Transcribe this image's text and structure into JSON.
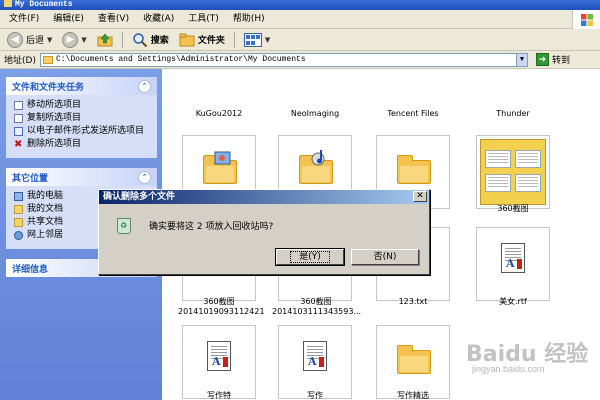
{
  "window": {
    "title": "My Documents"
  },
  "menubar": [
    "文件(F)",
    "编辑(E)",
    "查看(V)",
    "收藏(A)",
    "工具(T)",
    "帮助(H)"
  ],
  "toolbar": {
    "back_label": "后退",
    "search_label": "搜索",
    "folders_label": "文件夹"
  },
  "addressbar": {
    "label": "地址(D)",
    "path": "C:\\Documents and Settings\\Administrator\\My Documents",
    "go_label": "转到"
  },
  "taskpane": {
    "file_tasks": {
      "title": "文件和文件夹任务",
      "items": [
        "移动所选项目",
        "复制所选项目",
        "以电子邮件形式发送所选项目",
        "删除所选项目"
      ]
    },
    "other_places": {
      "title": "其它位置",
      "items": [
        "我的电脑",
        "我的文档",
        "共享文档",
        "网上邻居"
      ]
    },
    "details": {
      "title": "详细信息"
    }
  },
  "files": {
    "top_row_captions": [
      "KuGou2012",
      "NeoImaging",
      "Tencent Files",
      "Thunder"
    ],
    "screenshot_folder": "360截图",
    "caption_1": "360截图\n20141019093112421",
    "caption_2": "360截图\n2014103111343593...",
    "caption_3": "123.txt",
    "caption_4": "美女.rtf",
    "bottom_cap_1": "写作特",
    "bottom_cap_2": "写作",
    "bottom_cap_3": "写作精选"
  },
  "dialog": {
    "title": "确认删除多个文件",
    "message": "确实要将这 2 项放入回收站吗?",
    "yes_label": "是(Y)",
    "no_label": "否(N)"
  },
  "watermark": {
    "brand": "Baidu 经验",
    "url": "jingyan.baidu.com"
  }
}
